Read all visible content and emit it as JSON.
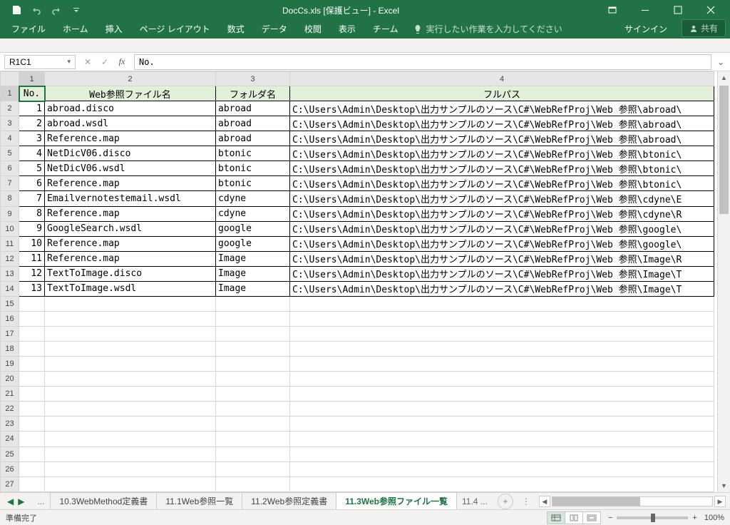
{
  "title": "DocCs.xls  [保護ビュー] - Excel",
  "qat": {
    "save": "保存",
    "undo": "元に戻す",
    "redo": "やり直し"
  },
  "ribbon": {
    "tabs": [
      "ファイル",
      "ホーム",
      "挿入",
      "ページ レイアウト",
      "数式",
      "データ",
      "校閲",
      "表示",
      "チーム"
    ],
    "tell_me": "実行したい作業を入力してください",
    "signin": "サインイン",
    "share": "共有"
  },
  "namebox": "R1C1",
  "formula": "No.",
  "columns": [
    "1",
    "2",
    "3",
    "4"
  ],
  "headers": {
    "no": "No.",
    "file": "Web参照ファイル名",
    "folder": "フォルダ名",
    "path": "フルパス"
  },
  "rows": [
    {
      "no": "1",
      "file": "abroad.disco",
      "folder": "abroad",
      "path": "C:\\Users\\Admin\\Desktop\\出力サンプルのソース\\C#\\WebRefProj\\Web 参照\\abroad\\"
    },
    {
      "no": "2",
      "file": "abroad.wsdl",
      "folder": "abroad",
      "path": "C:\\Users\\Admin\\Desktop\\出力サンプルのソース\\C#\\WebRefProj\\Web 参照\\abroad\\"
    },
    {
      "no": "3",
      "file": "Reference.map",
      "folder": "abroad",
      "path": "C:\\Users\\Admin\\Desktop\\出力サンプルのソース\\C#\\WebRefProj\\Web 参照\\abroad\\"
    },
    {
      "no": "4",
      "file": "NetDicV06.disco",
      "folder": "btonic",
      "path": "C:\\Users\\Admin\\Desktop\\出力サンプルのソース\\C#\\WebRefProj\\Web 参照\\btonic\\"
    },
    {
      "no": "5",
      "file": "NetDicV06.wsdl",
      "folder": "btonic",
      "path": "C:\\Users\\Admin\\Desktop\\出力サンプルのソース\\C#\\WebRefProj\\Web 参照\\btonic\\"
    },
    {
      "no": "6",
      "file": "Reference.map",
      "folder": "btonic",
      "path": "C:\\Users\\Admin\\Desktop\\出力サンプルのソース\\C#\\WebRefProj\\Web 参照\\btonic\\"
    },
    {
      "no": "7",
      "file": "Emailvernotestemail.wsdl",
      "folder": "cdyne",
      "path": "C:\\Users\\Admin\\Desktop\\出力サンプルのソース\\C#\\WebRefProj\\Web 参照\\cdyne\\E"
    },
    {
      "no": "8",
      "file": "Reference.map",
      "folder": "cdyne",
      "path": "C:\\Users\\Admin\\Desktop\\出力サンプルのソース\\C#\\WebRefProj\\Web 参照\\cdyne\\R"
    },
    {
      "no": "9",
      "file": "GoogleSearch.wsdl",
      "folder": "google",
      "path": "C:\\Users\\Admin\\Desktop\\出力サンプルのソース\\C#\\WebRefProj\\Web 参照\\google\\"
    },
    {
      "no": "10",
      "file": "Reference.map",
      "folder": "google",
      "path": "C:\\Users\\Admin\\Desktop\\出力サンプルのソース\\C#\\WebRefProj\\Web 参照\\google\\"
    },
    {
      "no": "11",
      "file": "Reference.map",
      "folder": "Image",
      "path": "C:\\Users\\Admin\\Desktop\\出力サンプルのソース\\C#\\WebRefProj\\Web 参照\\Image\\R"
    },
    {
      "no": "12",
      "file": "TextToImage.disco",
      "folder": "Image",
      "path": "C:\\Users\\Admin\\Desktop\\出力サンプルのソース\\C#\\WebRefProj\\Web 参照\\Image\\T"
    },
    {
      "no": "13",
      "file": "TextToImage.wsdl",
      "folder": "Image",
      "path": "C:\\Users\\Admin\\Desktop\\出力サンプルのソース\\C#\\WebRefProj\\Web 参照\\Image\\T"
    }
  ],
  "empty_rows": [
    "15",
    "16",
    "17",
    "18",
    "19",
    "20",
    "21",
    "22",
    "23",
    "24",
    "25",
    "26",
    "27"
  ],
  "sheets": {
    "more_left": "...",
    "tabs": [
      "10.3WebMethod定義書",
      "11.1Web参照一覧",
      "11.2Web参照定義書",
      "11.3Web参照ファイル一覧"
    ],
    "active_index": 3,
    "more_right": "11.4 ..."
  },
  "status": {
    "ready": "準備完了",
    "zoom": "100%"
  }
}
